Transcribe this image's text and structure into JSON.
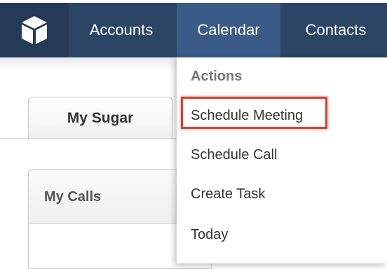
{
  "nav": {
    "items": [
      {
        "label": "Accounts"
      },
      {
        "label": "Calendar"
      },
      {
        "label": "Contacts"
      }
    ],
    "active": "Calendar"
  },
  "dashboard": {
    "tab_label": "My Sugar",
    "dashlet_title": "My Calls"
  },
  "dropdown": {
    "heading": "Actions",
    "items": [
      {
        "label": "Schedule Meeting"
      },
      {
        "label": "Schedule Call"
      },
      {
        "label": "Create Task"
      },
      {
        "label": "Today"
      }
    ]
  },
  "colors": {
    "nav_bg": "#2c4565",
    "nav_active": "#3a5b87",
    "highlight": "#e53a28"
  }
}
